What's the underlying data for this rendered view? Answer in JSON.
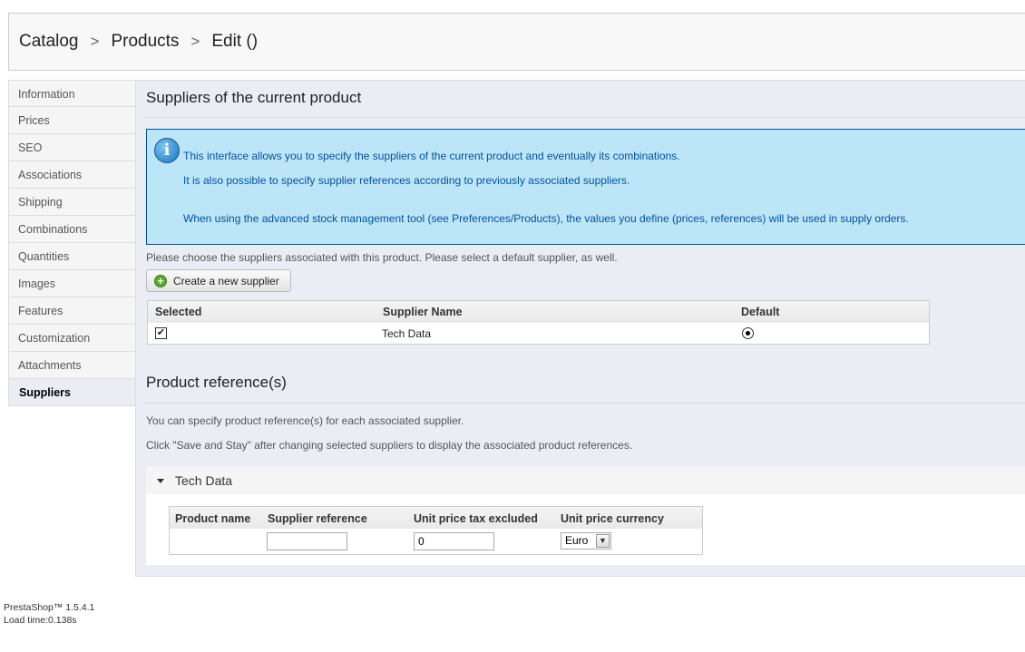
{
  "breadcrumb": {
    "items": [
      "Catalog",
      "Products",
      "Edit ()"
    ],
    "separator": ">"
  },
  "tabs": [
    {
      "label": "Information",
      "active": false
    },
    {
      "label": "Prices",
      "active": false
    },
    {
      "label": "SEO",
      "active": false
    },
    {
      "label": "Associations",
      "active": false
    },
    {
      "label": "Shipping",
      "active": false
    },
    {
      "label": "Combinations",
      "active": false
    },
    {
      "label": "Quantities",
      "active": false
    },
    {
      "label": "Images",
      "active": false
    },
    {
      "label": "Features",
      "active": false
    },
    {
      "label": "Customization",
      "active": false
    },
    {
      "label": "Attachments",
      "active": false
    },
    {
      "label": "Suppliers",
      "active": true
    }
  ],
  "suppliers_section": {
    "title": "Suppliers of the current product",
    "info_icon": "i",
    "info_lines": [
      "This interface allows you to specify the suppliers of the current product and eventually its combinations.",
      "It is also possible to specify supplier references according to previously associated suppliers.",
      "When using the advanced stock management tool (see Preferences/Products), the values you define (prices, references) will be used in supply orders."
    ],
    "instruction": "Please choose the suppliers associated with this product. Please select a default supplier, as well.",
    "create_button": "Create a new supplier",
    "table": {
      "headers": [
        "Selected",
        "Supplier Name",
        "Default"
      ],
      "rows": [
        {
          "selected": true,
          "name": "Tech Data",
          "default": true
        }
      ]
    }
  },
  "references_section": {
    "title": "Product reference(s)",
    "line1": "You can specify product reference(s) for each associated supplier.",
    "line2": "Click \"Save and Stay\" after changing selected suppliers to display the associated product references.",
    "supplier_name": "Tech Data",
    "table": {
      "headers": [
        "Product name",
        "Supplier reference",
        "Unit price tax excluded",
        "Unit price currency"
      ],
      "row": {
        "product_name": "",
        "supplier_reference": "",
        "unit_price": "0",
        "currency": "Euro"
      }
    }
  },
  "footer": {
    "version": "PrestaShop™ 1.5.4.1",
    "load_time": "Load time:0.138s"
  },
  "icons": {
    "checkbox_mark": "✔",
    "select_arrow": "▼",
    "plus": "+"
  }
}
